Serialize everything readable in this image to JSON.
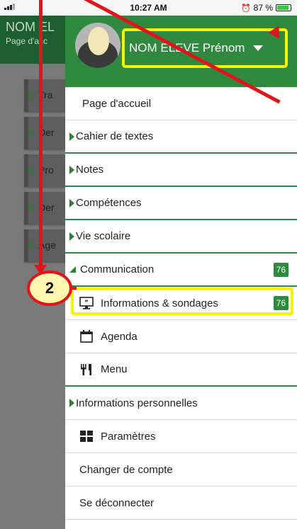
{
  "status": {
    "time": "10:27 AM",
    "battery": "87 %"
  },
  "background": {
    "title": "NOM EL",
    "subtitle": "Page d'acc",
    "items": [
      "Tra",
      "Der",
      "Pro",
      "Der",
      "Age"
    ]
  },
  "drawer": {
    "profile_name": "NOM ELEVE Prénom",
    "menu": [
      {
        "label": "Page d'accueil"
      },
      {
        "label": "Cahier de textes"
      },
      {
        "label": "Notes"
      },
      {
        "label": "Compétences"
      },
      {
        "label": "Vie scolaire"
      },
      {
        "label": "Communication",
        "badge": "76"
      },
      {
        "label": "Informations & sondages",
        "badge": "76"
      },
      {
        "label": "Agenda"
      },
      {
        "label": "Menu"
      },
      {
        "label": "Informations personnelles"
      },
      {
        "label": "Paramètres"
      },
      {
        "label": "Changer de compte"
      },
      {
        "label": "Se déconnecter"
      }
    ]
  },
  "annotation": {
    "step": "2"
  },
  "colors": {
    "accent": "#2f8a3f",
    "highlight": "#f6f300",
    "arrow": "#e0141a"
  },
  "icons": [
    "signal-icon",
    "alarm-icon",
    "battery-icon",
    "caret-down-icon",
    "board-quote-icon",
    "calendar-icon",
    "utensils-icon",
    "grid-icon"
  ]
}
